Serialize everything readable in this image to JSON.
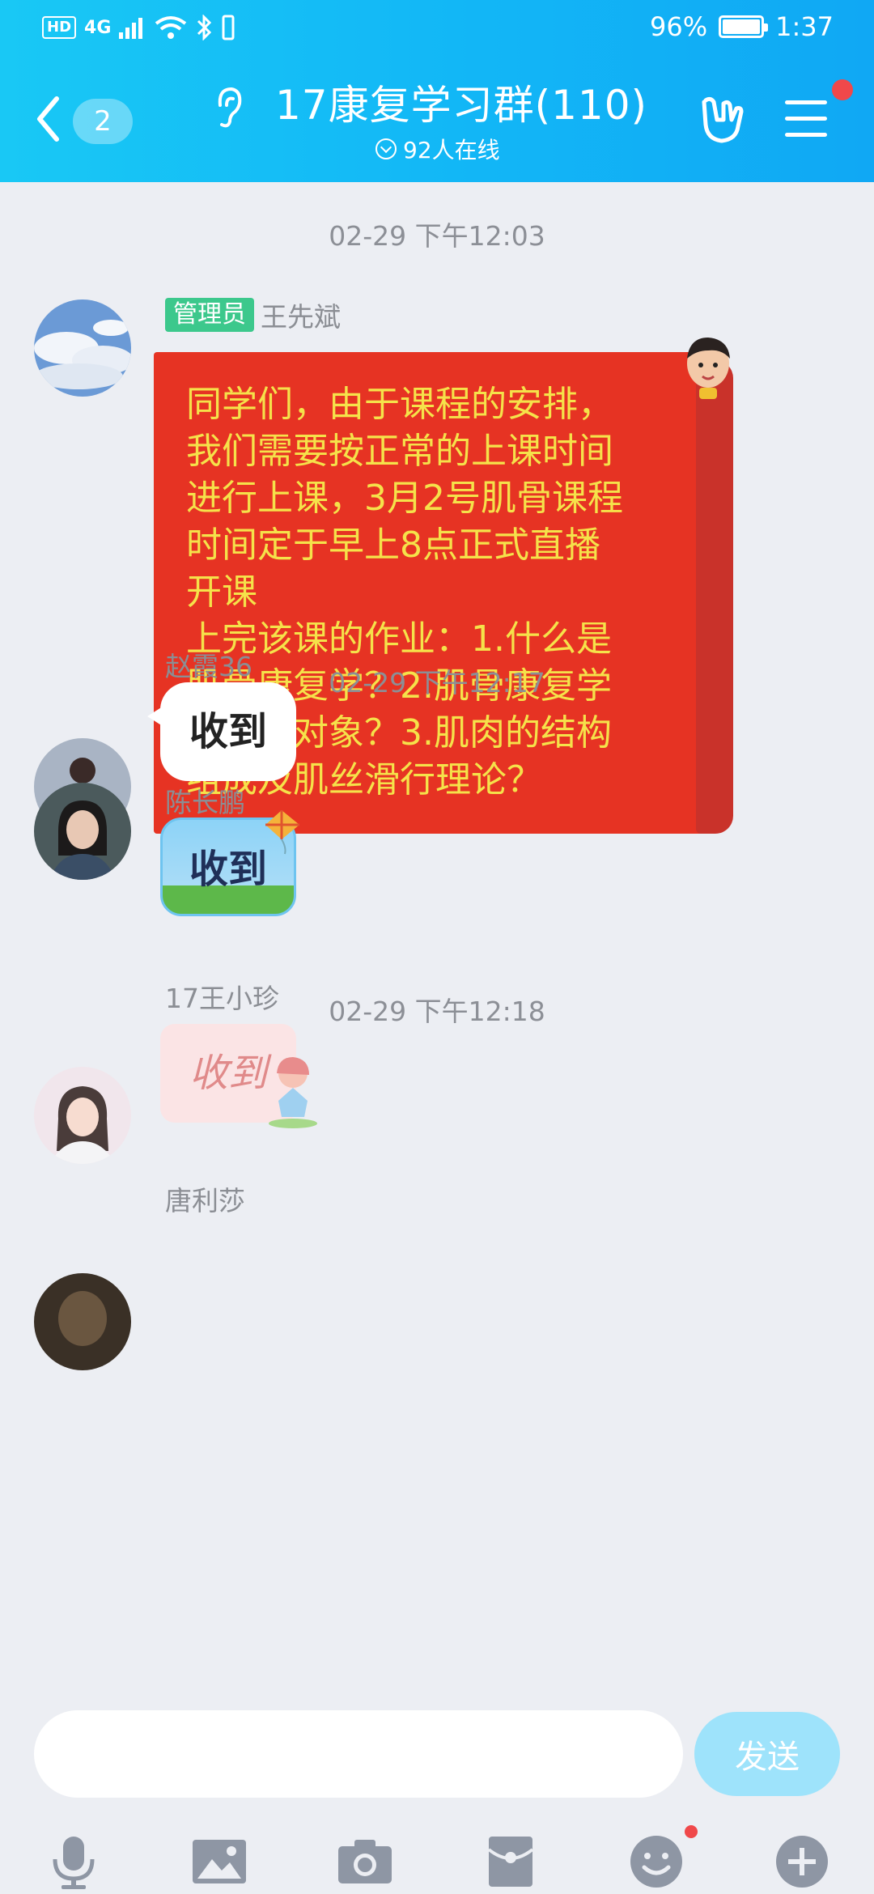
{
  "status_bar": {
    "network": "4G",
    "hd": "HD",
    "battery": "96%",
    "time": "1:37"
  },
  "header": {
    "unread_count": "2",
    "title": "17康复学习群(110)",
    "online": "92人在线"
  },
  "messages": [
    {
      "time": "02-29 下午12:03",
      "badge": "管理员",
      "sender": "王先斌",
      "text": "同学们，由于课程的安排，\n我们需要按正常的上课时间\n进行上课，3月2号肌骨课程\n时间定于早上8点正式直播\n开课\n上完该课的作业：1.什么是\n肌骨康复学？2.肌骨康复学\n的研究对象？3.肌肉的结构\n组成及肌丝滑行理论？"
    },
    {
      "time": "02-29 下午12:17",
      "sender": "赵霞36",
      "text": "收到"
    },
    {
      "sender": "陈长鹏",
      "text": "收到"
    },
    {
      "time": "02-29 下午12:18",
      "sender": "17王小珍",
      "text": "收到"
    },
    {
      "sender": "唐利莎"
    }
  ],
  "input": {
    "placeholder": "",
    "send_label": "发送"
  },
  "toolbar": [
    "microphone-icon",
    "image-icon",
    "camera-icon",
    "red-packet-icon",
    "emoji-icon",
    "plus-icon"
  ],
  "colors": {
    "header": "#12b6f6",
    "red_message": "#e63323",
    "red_text": "#f5e24a",
    "admin_badge": "#3cc88c"
  }
}
